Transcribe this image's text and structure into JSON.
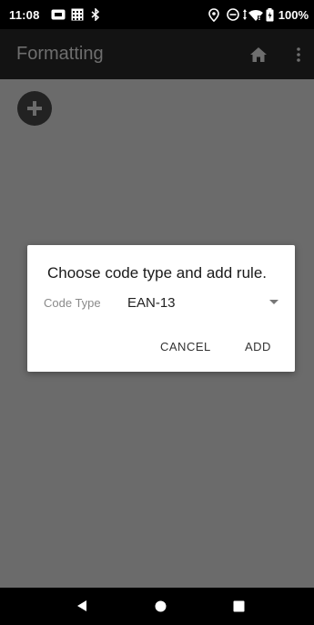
{
  "status_bar": {
    "time": "11:08",
    "battery": "100%",
    "icons": [
      "message-icon",
      "calendar-icon",
      "bluetooth-icon",
      "location-icon",
      "dnd-icon",
      "wifi-icon",
      "battery-icon"
    ]
  },
  "app_bar": {
    "title": "Formatting",
    "icons": [
      "home-icon",
      "more-vert-icon"
    ]
  },
  "content": {
    "add_icon": "plus-icon"
  },
  "dialog": {
    "title": "Choose code type and add rule.",
    "field_label": "Code Type",
    "selected_value": "EAN-13",
    "cancel_label": "CANCEL",
    "add_label": "ADD"
  },
  "nav_bar": {
    "icons": [
      "back-icon",
      "home-circle-icon",
      "recents-icon"
    ]
  },
  "colors": {
    "app_bar": "#131313",
    "overlay": "#6b6b6b",
    "dialog": "#ffffff",
    "title_text": "#6e6e6e"
  }
}
